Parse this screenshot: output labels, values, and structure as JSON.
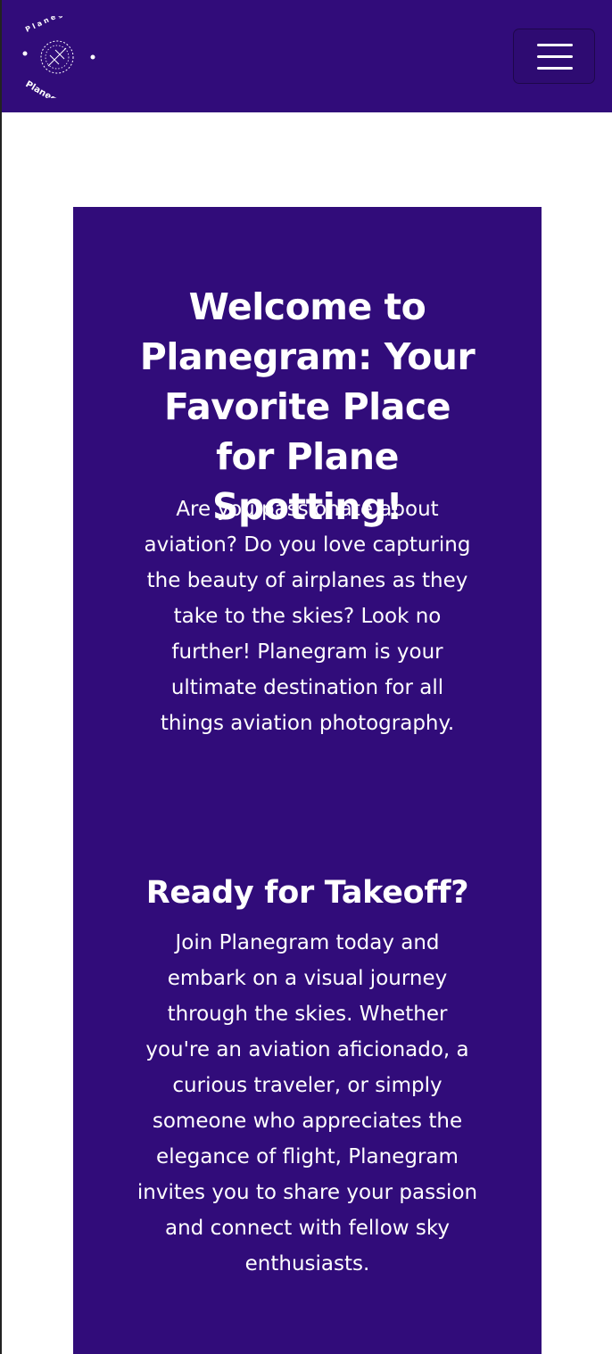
{
  "navbar": {
    "logo_text": "Planegram",
    "menu_icon": "hamburger-menu-icon",
    "background_color": "#310c7a"
  },
  "hero": {
    "title": "Welcome to Planegram: Your Favorite Place for Plane Spotting!",
    "intro": "Are you passionate about aviation? Do you love capturing the beauty of airplanes as they take to the skies? Look no further! Planegram is your ultimate destination for all things aviation photography.",
    "subtitle": "Ready for Takeoff?",
    "join_text": "Join Planegram today and embark on a visual journey through the skies. Whether you're an aviation aficionado, a curious traveler, or simply someone who appreciates the elegance of flight, Planegram invites you to share your passion and connect with fellow sky enthusiasts.",
    "background_color": "#310c7a",
    "text_color": "#ffffff"
  }
}
